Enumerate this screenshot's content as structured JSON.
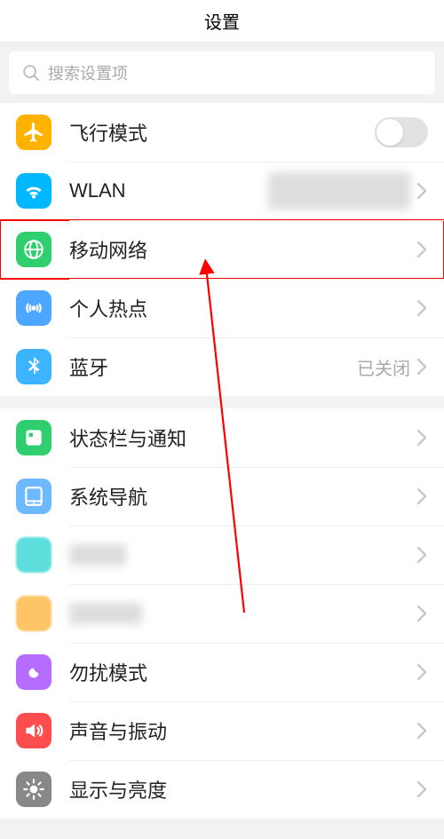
{
  "header": {
    "title": "设置"
  },
  "search": {
    "placeholder": "搜索设置项"
  },
  "groups": [
    {
      "items": [
        {
          "id": "airplane",
          "label": "飞行模式",
          "control": "toggle",
          "toggled": false,
          "iconBg": "#ffb300"
        },
        {
          "id": "wlan",
          "label": "WLAN",
          "control": "chevron",
          "value_blurred": true,
          "iconBg": "#00b8ff"
        },
        {
          "id": "mobile-network",
          "label": "移动网络",
          "control": "chevron",
          "highlighted": true,
          "iconBg": "#2fcf70"
        },
        {
          "id": "hotspot",
          "label": "个人热点",
          "control": "chevron",
          "iconBg": "#4da6ff"
        },
        {
          "id": "bluetooth",
          "label": "蓝牙",
          "control": "chevron",
          "value": "已关闭",
          "iconBg": "#3cb4ff"
        }
      ]
    },
    {
      "items": [
        {
          "id": "status-bar",
          "label": "状态栏与通知",
          "control": "chevron",
          "iconBg": "#2fcf70"
        },
        {
          "id": "system-nav",
          "label": "系统导航",
          "control": "chevron",
          "iconBg": "#6db8ff"
        },
        {
          "id": "blur1",
          "label_blurred": true,
          "control": "chevron",
          "iconBg": "#5fdede",
          "icon_blurred": true
        },
        {
          "id": "blur2",
          "label_blurred": true,
          "control": "chevron",
          "iconBg": "#ffc466",
          "icon_blurred": true
        },
        {
          "id": "dnd",
          "label": "勿扰模式",
          "control": "chevron",
          "iconBg": "#b46dff"
        },
        {
          "id": "sound",
          "label": "声音与振动",
          "control": "chevron",
          "iconBg": "#ff4d4d"
        },
        {
          "id": "display",
          "label": "显示与亮度",
          "control": "chevron",
          "iconBg": "#888888"
        }
      ]
    }
  ]
}
